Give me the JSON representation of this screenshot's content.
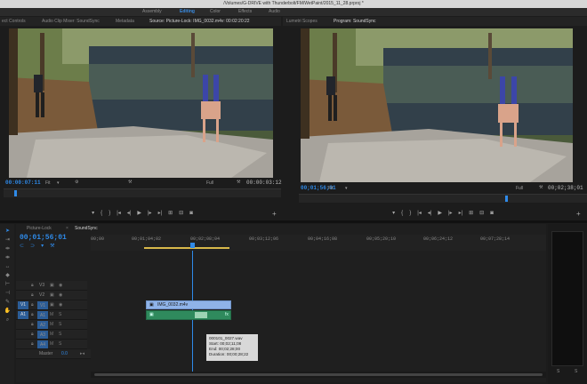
{
  "window": {
    "title": "/Volumes/G-DRIVE with Thunderbolt/FM/WetPaint/2015_11_28.prproj *"
  },
  "workspaces": {
    "items": [
      "Assembly",
      "Editing",
      "Color",
      "Effects",
      "Audio"
    ],
    "active": "Editing"
  },
  "source_panel": {
    "tabs": [
      "ect Controls",
      "Audio Clip Mixer: SoundSync",
      "Metadata",
      "Source: Picture-Lock: IMG_0032.m4v: 00:02:20:22"
    ],
    "active_tab": "Source: Picture-Lock: IMG_0032.m4v: 00:02:20:22",
    "timecode": "00:00:07:11",
    "fit": "Fit",
    "quality": "Full",
    "duration": "00:00:03:12"
  },
  "program_panel": {
    "tabs": [
      "Lumetri Scopes",
      "Program: SoundSync"
    ],
    "active_tab": "Program: SoundSync",
    "timecode": "00;01;56;01",
    "fit": "Fit",
    "quality": "Full",
    "duration": "00;02;38;01"
  },
  "transport": {
    "icons": [
      "marker-icon",
      "in-point-icon",
      "out-point-icon",
      "go-to-in-icon",
      "step-back-icon",
      "play-icon",
      "step-forward-icon",
      "go-to-out-icon",
      "insert-icon",
      "overwrite-icon",
      "export-frame-icon",
      "add-button-icon"
    ]
  },
  "timeline": {
    "tabs": [
      "Picture-Lock",
      "SoundSync"
    ],
    "active_tab": "SoundSync",
    "timecode": "00;01;56;01",
    "ruler_labels": [
      "00;00",
      "00;01;04;02",
      "00;02;08;04",
      "00;03;12;06",
      "00;04;16;08",
      "00;05;20;10",
      "00;06;24;12",
      "00;07;28;14"
    ],
    "video_tracks": [
      "V3",
      "V2",
      "V1"
    ],
    "audio_tracks": [
      "A1",
      "A2",
      "A3",
      "A4"
    ],
    "master_label": "Master",
    "master_value": "0.0",
    "video_clip": "IMG_0032.m4v",
    "audio_clip_marker": "fx",
    "tooltip": {
      "name": "000101_0027.wav",
      "start": "Start: 00;02;11;08",
      "end": "End: 00;02;28;00",
      "duration": "Duration: 00;00;28;22"
    }
  },
  "meters": {
    "labels": [
      "S",
      "S"
    ]
  },
  "colors": {
    "accent": "#2f8ae8",
    "video_clip": "#8fb3e8",
    "audio_clip": "#2f8a5d",
    "inout_bar": "#d8b84a"
  }
}
